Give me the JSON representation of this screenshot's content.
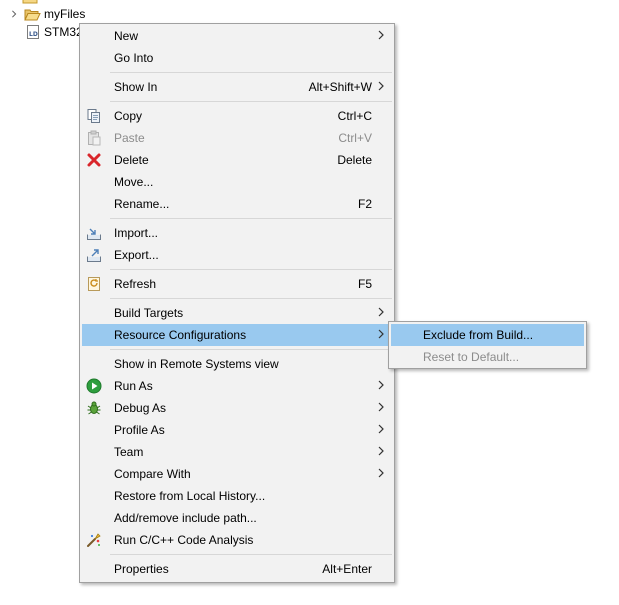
{
  "tree": {
    "items": [
      {
        "label": "myFiles",
        "icon": "folder-open-icon"
      },
      {
        "label": "STM32",
        "icon": "linker-script-file-icon"
      }
    ]
  },
  "context_menu": {
    "items": {
      "new": {
        "label": "New",
        "submenu": true
      },
      "go_into": {
        "label": "Go Into"
      },
      "show_in": {
        "label": "Show In",
        "shortcut": "Alt+Shift+W",
        "submenu": true
      },
      "copy": {
        "label": "Copy",
        "shortcut": "Ctrl+C",
        "icon": "copy-icon"
      },
      "paste": {
        "label": "Paste",
        "shortcut": "Ctrl+V",
        "icon": "paste-icon",
        "disabled": true
      },
      "delete": {
        "label": "Delete",
        "shortcut": "Delete",
        "icon": "delete-icon"
      },
      "move": {
        "label": "Move..."
      },
      "rename": {
        "label": "Rename...",
        "shortcut": "F2"
      },
      "import": {
        "label": "Import...",
        "icon": "import-icon"
      },
      "export": {
        "label": "Export...",
        "icon": "export-icon"
      },
      "refresh": {
        "label": "Refresh",
        "shortcut": "F5",
        "icon": "refresh-icon"
      },
      "build_targets": {
        "label": "Build Targets",
        "submenu": true
      },
      "resource_configurations": {
        "label": "Resource Configurations",
        "submenu": true,
        "highlighted": true
      },
      "show_in_remote": {
        "label": "Show in Remote Systems view"
      },
      "run_as": {
        "label": "Run As",
        "icon": "run-icon",
        "submenu": true
      },
      "debug_as": {
        "label": "Debug As",
        "icon": "debug-bug-icon",
        "submenu": true
      },
      "profile_as": {
        "label": "Profile As",
        "submenu": true
      },
      "team": {
        "label": "Team",
        "submenu": true
      },
      "compare_with": {
        "label": "Compare With",
        "submenu": true
      },
      "restore_history": {
        "label": "Restore from Local History..."
      },
      "add_remove_include": {
        "label": "Add/remove include path..."
      },
      "run_code_analysis": {
        "label": "Run C/C++ Code Analysis",
        "icon": "code-analysis-icon"
      },
      "properties": {
        "label": "Properties",
        "shortcut": "Alt+Enter"
      }
    }
  },
  "submenu": {
    "items": {
      "exclude": {
        "label": "Exclude from Build...",
        "highlighted": true
      },
      "reset": {
        "label": "Reset to Default...",
        "disabled": true
      }
    }
  },
  "colors": {
    "menu_bg": "#f2f2f2",
    "highlight": "#99c9ef",
    "disabled_text": "#8c8c8c",
    "separator": "#d7d7d7"
  }
}
